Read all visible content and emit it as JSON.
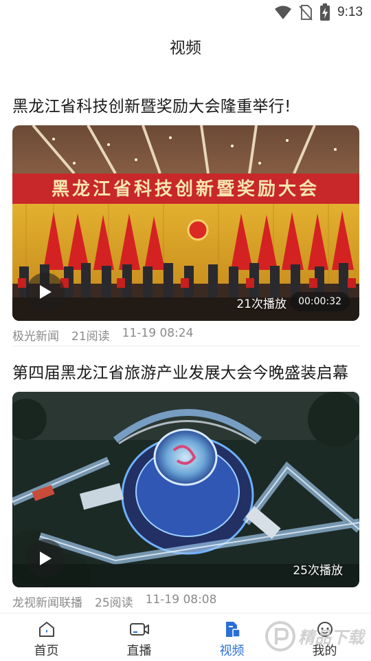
{
  "status_bar": {
    "time": "9:13"
  },
  "header": {
    "title": "视频"
  },
  "videos": [
    {
      "title": "黑龙江省科技创新暨奖励大会隆重举行!",
      "thumb_banner": "黑龙江省科技创新暨奖励大会",
      "play_count": "21次播放",
      "duration": "00:00:32",
      "source": "极光新闻",
      "reads": "21阅读",
      "time": "11-19 08:24"
    },
    {
      "title": "第四届黑龙江省旅游产业发展大会今晚盛装启幕",
      "play_count": "25次播放",
      "source": "龙视新闻联播",
      "reads": "25阅读",
      "time": "11-19 08:08"
    }
  ],
  "bottom_nav": [
    {
      "label": "首页",
      "icon": "home-icon"
    },
    {
      "label": "直播",
      "icon": "camera-icon"
    },
    {
      "label": "视频",
      "icon": "video-doc-icon",
      "active": true
    },
    {
      "label": "我的",
      "icon": "user-icon"
    }
  ],
  "watermark": {
    "text": "精品下载"
  },
  "colors": {
    "accent": "#2a6fd6",
    "meta_text": "#8a8a8a"
  }
}
